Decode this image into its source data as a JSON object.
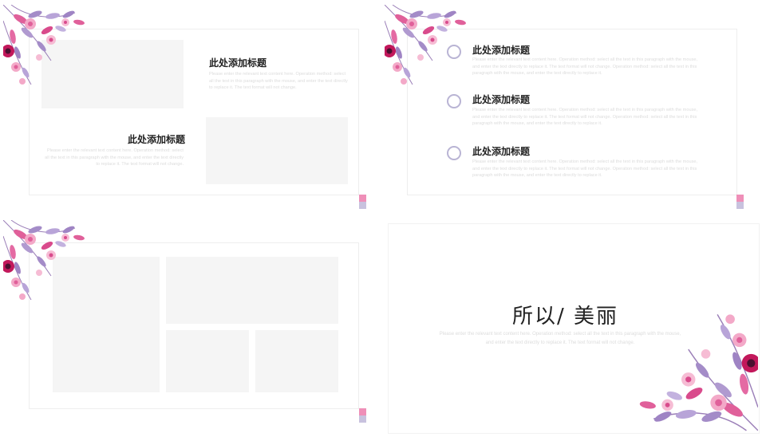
{
  "slide1": {
    "title_right": "此处添加标题",
    "body_right": "Please enter the relevant text content here. Operation method: select all the text in this paragraph with the mouse, and enter the text directly to replace it. The text format will not change.",
    "title_left": "此处添加标题",
    "body_left": "Please enter the relevant text content here. Operation method: select all the text in this paragraph with the mouse, and enter the text directly to replace it. The text format will not change."
  },
  "slide2": {
    "items": [
      {
        "title": "此处添加标题",
        "body": "Please enter the relevant text content here. Operation method: select all the text in this paragraph with the mouse, and enter the text directly to replace it. The text format will not change. Operation method: select all the text in this paragraph with the mouse, and enter the text directly to replace it."
      },
      {
        "title": "此处添加标题",
        "body": "Please enter the relevant text content here. Operation method: select all the text in this paragraph with the mouse, and enter the text directly to replace it. The text format will not change. Operation method: select all the text in this paragraph with the mouse, and enter the text directly to replace it."
      },
      {
        "title": "此处添加标题",
        "body": "Please enter the relevant text content here. Operation method: select all the text in this paragraph with the mouse, and enter the text directly to replace it. The text format will not change. Operation method: select all the text in this paragraph with the mouse, and enter the text directly to replace it."
      }
    ]
  },
  "slide4": {
    "title": "所以/ 美丽",
    "body": "Please enter the relevant text content here. Operation method: select all the text in this paragraph with the mouse, and enter the text directly to replace it. The text format will not change."
  },
  "colors": {
    "accent_pink": "#ef8fb8",
    "accent_lavender": "#c8c2de",
    "circle_border": "#b9b4d4",
    "placeholder": "#f5f5f5"
  },
  "icons": {
    "floral_corner": "floral-corner-decoration",
    "list_bullet": "ring-circle-icon"
  }
}
